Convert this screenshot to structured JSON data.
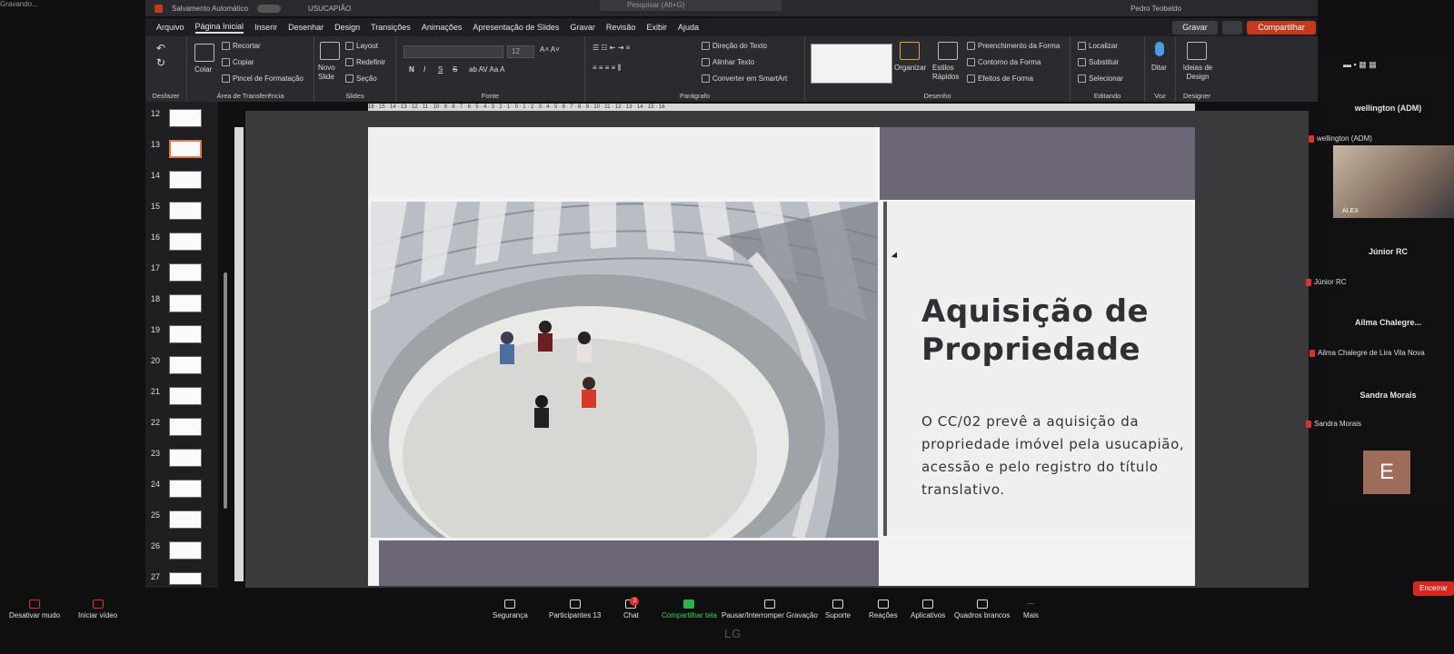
{
  "top": {
    "left_label": "Gravando...",
    "autosave": "Salvamento Automático",
    "filename": "USUCAPIÃO",
    "search_placeholder": "Pesquisar (Alt+G)",
    "user": "Pedro Teobaldo"
  },
  "menu": {
    "items": [
      "Arquivo",
      "Página Inicial",
      "Inserir",
      "Desenhar",
      "Design",
      "Transições",
      "Animações",
      "Apresentação de Slides",
      "Gravar",
      "Revisão",
      "Exibir",
      "Ajuda"
    ],
    "record_button": "Gravar",
    "share_button": "Compartilhar"
  },
  "ribbon": {
    "undo_group": "Desfazer",
    "clipboard": {
      "paste": "Colar",
      "cut": "Recortar",
      "copy": "Copiar",
      "format_painter": "Pincel de Formatação",
      "label": "Área de Transferência"
    },
    "slides": {
      "new_slide": "Novo Slide",
      "layout": "Layout",
      "reset": "Redefinir",
      "section": "Seção",
      "label": "Slides"
    },
    "font": {
      "size": "12",
      "bold": "N",
      "italic": "I",
      "underline": "S",
      "strike": "S",
      "label": "Fonte"
    },
    "paragraph": {
      "text_direction": "Direção do Texto",
      "align_text": "Alinhar Texto",
      "smartart": "Converter em SmartArt",
      "label": "Parágrafo"
    },
    "drawing": {
      "arrange": "Organizar",
      "quick_styles": "Estilos Rápidos",
      "fill": "Preenchimento da Forma",
      "outline": "Contorno da Forma",
      "effects": "Efeitos de Forma",
      "label": "Desenho"
    },
    "editing": {
      "find": "Localizar",
      "replace": "Substituir",
      "select": "Selecionar",
      "label": "Editando"
    },
    "voice": {
      "dictate": "Ditar",
      "label": "Voz"
    },
    "designer": {
      "ideas": "Ideias de Design",
      "label": "Designer"
    }
  },
  "thumbnails": {
    "numbers": [
      "12",
      "13",
      "14",
      "15",
      "16",
      "17",
      "18",
      "19",
      "20",
      "21",
      "22",
      "23",
      "24",
      "25",
      "26",
      "27"
    ],
    "selected": "13"
  },
  "ruler_text": "16 · 15 · 14 · 13 · 12 · 11 · 10 · 9 · 8 · 7 · 6 · 5 · 4 · 3 · 2 · 1 · 0 · 1 · 2 · 3 · 4 · 5 · 6 · 7 · 8 · 9 · 10 · 11 · 12 · 13 · 14 · 15 · 16",
  "slide": {
    "title_line1": "Aquisição de",
    "title_line2": "Propriedade",
    "body": "O CC/02 prevê a aquisição da propriedade imóvel pela usucapião, acessão e pelo registro do título translativo."
  },
  "participants": {
    "p1_name": "wellington (ADM)",
    "p1_label": "wellington (ADM)",
    "p1_video_label": "ALEX",
    "p2_name": "Júnior RC",
    "p2_label": "Júnior RC",
    "p3_name": "Ailma  Chalegre...",
    "p3_label": "Ailma Chalegre de Lira Vila Nova",
    "p4_name": "Sandra Morais",
    "p4_label": "Sandra Morais",
    "p5_initial": "E"
  },
  "zoom": {
    "mute": "Desativar mudo",
    "video": "Iniciar vídeo",
    "security": "Segurança",
    "participants": "Participantes",
    "participants_count": "13",
    "chat": "Chat",
    "chat_badge": "2",
    "share": "Compartilhar tela",
    "pause_record": "Pausar/Interromper Gravação",
    "support": "Suporte",
    "reactions": "Reações",
    "apps": "Aplicativos",
    "whiteboards": "Quadros brancos",
    "more": "Mais",
    "end": "Encerrar"
  },
  "monitor_brand": "LG"
}
